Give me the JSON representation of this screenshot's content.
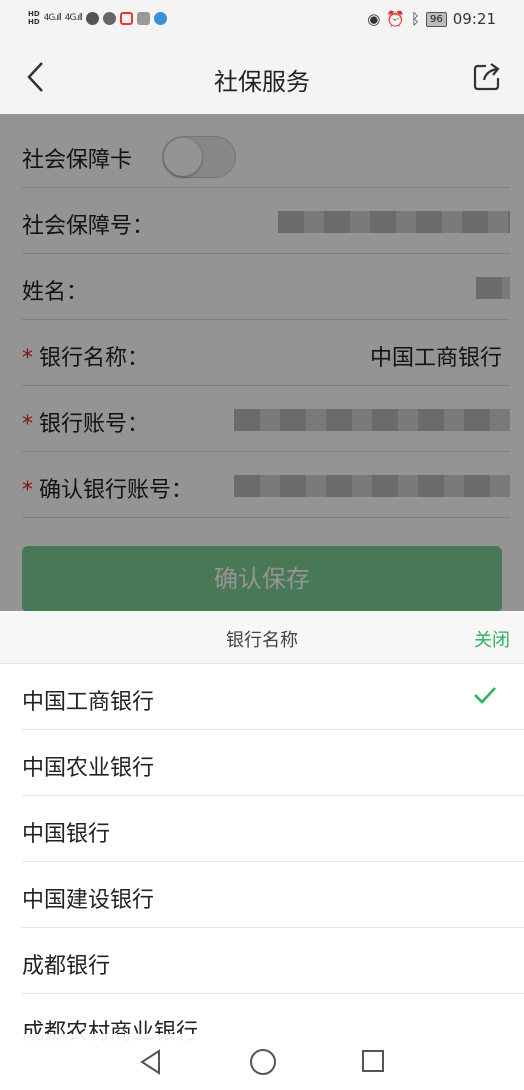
{
  "status_bar": {
    "net1": "4G",
    "net2": "4G",
    "battery": "96",
    "time": "09:21"
  },
  "header": {
    "title": "社保服务"
  },
  "form": {
    "card_toggle_label": "社会保障卡",
    "card_toggle_on": false,
    "ssn_label": "社会保障号：",
    "name_label": "姓名：",
    "bank_name_label": "银行名称：",
    "bank_name_value": "中国工商银行",
    "bank_account_label": "银行账号：",
    "confirm_account_label": "确认银行账号：",
    "required_mark": "*",
    "save_label": "确认保存"
  },
  "sheet": {
    "title": "银行名称",
    "close_label": "关闭",
    "options": [
      {
        "label": "中国工商银行",
        "selected": true
      },
      {
        "label": "中国农业银行",
        "selected": false
      },
      {
        "label": "中国银行",
        "selected": false
      },
      {
        "label": "中国建设银行",
        "selected": false
      },
      {
        "label": "成都银行",
        "selected": false
      },
      {
        "label": "成都农村商业银行",
        "selected": false
      }
    ]
  },
  "colors": {
    "accent_green": "#2bb35a",
    "button_green": "#7fcf95",
    "required_red": "#d22222"
  }
}
